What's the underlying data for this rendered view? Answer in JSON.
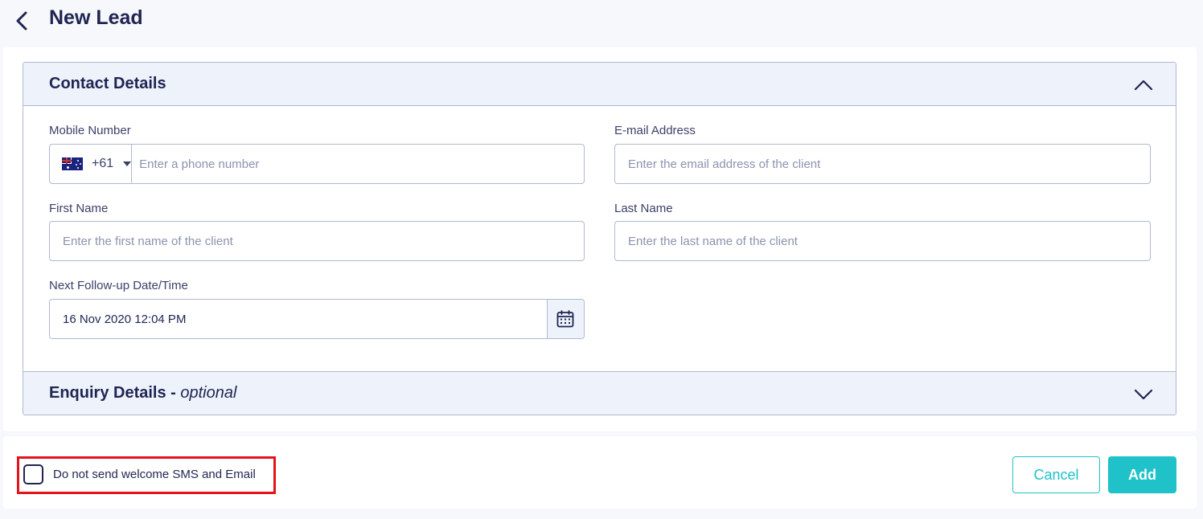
{
  "header": {
    "title": "New Lead",
    "back_icon": "chevron-left-icon"
  },
  "contact_section": {
    "title": "Contact Details",
    "expanded": true,
    "toggle_icon": "chevron-up-icon",
    "mobile": {
      "label": "Mobile Number",
      "country_flag": "australia-flag-icon",
      "dial_code": "+61",
      "placeholder": "Enter a phone number",
      "value": ""
    },
    "email": {
      "label": "E-mail Address",
      "placeholder": "Enter the email address of the client",
      "value": ""
    },
    "first_name": {
      "label": "First Name",
      "placeholder": "Enter the first name of the client",
      "value": ""
    },
    "last_name": {
      "label": "Last Name",
      "placeholder": "Enter the last name of the client",
      "value": ""
    },
    "follow_up": {
      "label": "Next Follow-up Date/Time",
      "value": "16 Nov 2020 12:04 PM",
      "icon": "calendar-icon"
    }
  },
  "enquiry_section": {
    "title": "Enquiry Details - ",
    "title_suffix": "optional",
    "expanded": false,
    "toggle_icon": "chevron-down-icon"
  },
  "footer": {
    "checkbox_label": "Do not send welcome SMS and Email",
    "checkbox_checked": false,
    "cancel_label": "Cancel",
    "add_label": "Add"
  },
  "colors": {
    "primary_text": "#1f2552",
    "accent": "#1fc2c9",
    "section_header_bg": "#eef2fb",
    "border": "#aeb8d1",
    "highlight": "#e3141b"
  }
}
